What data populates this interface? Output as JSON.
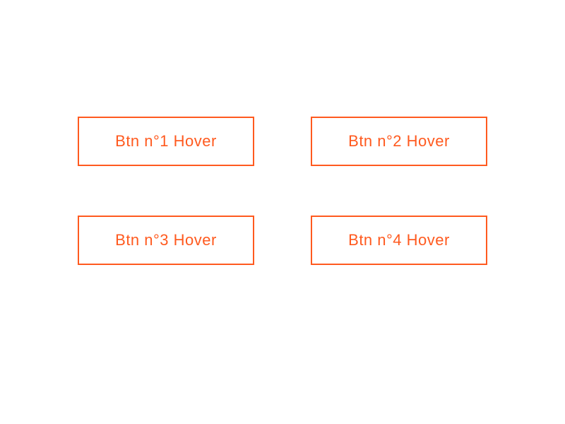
{
  "buttons": {
    "btn1": {
      "label": "Btn n°1 Hover"
    },
    "btn2": {
      "label": "Btn n°2 Hover"
    },
    "btn3": {
      "label": "Btn n°3 Hover"
    },
    "btn4": {
      "label": "Btn n°4 Hover"
    }
  },
  "colors": {
    "accent": "#ff5a1f",
    "background": "#ffffff"
  }
}
